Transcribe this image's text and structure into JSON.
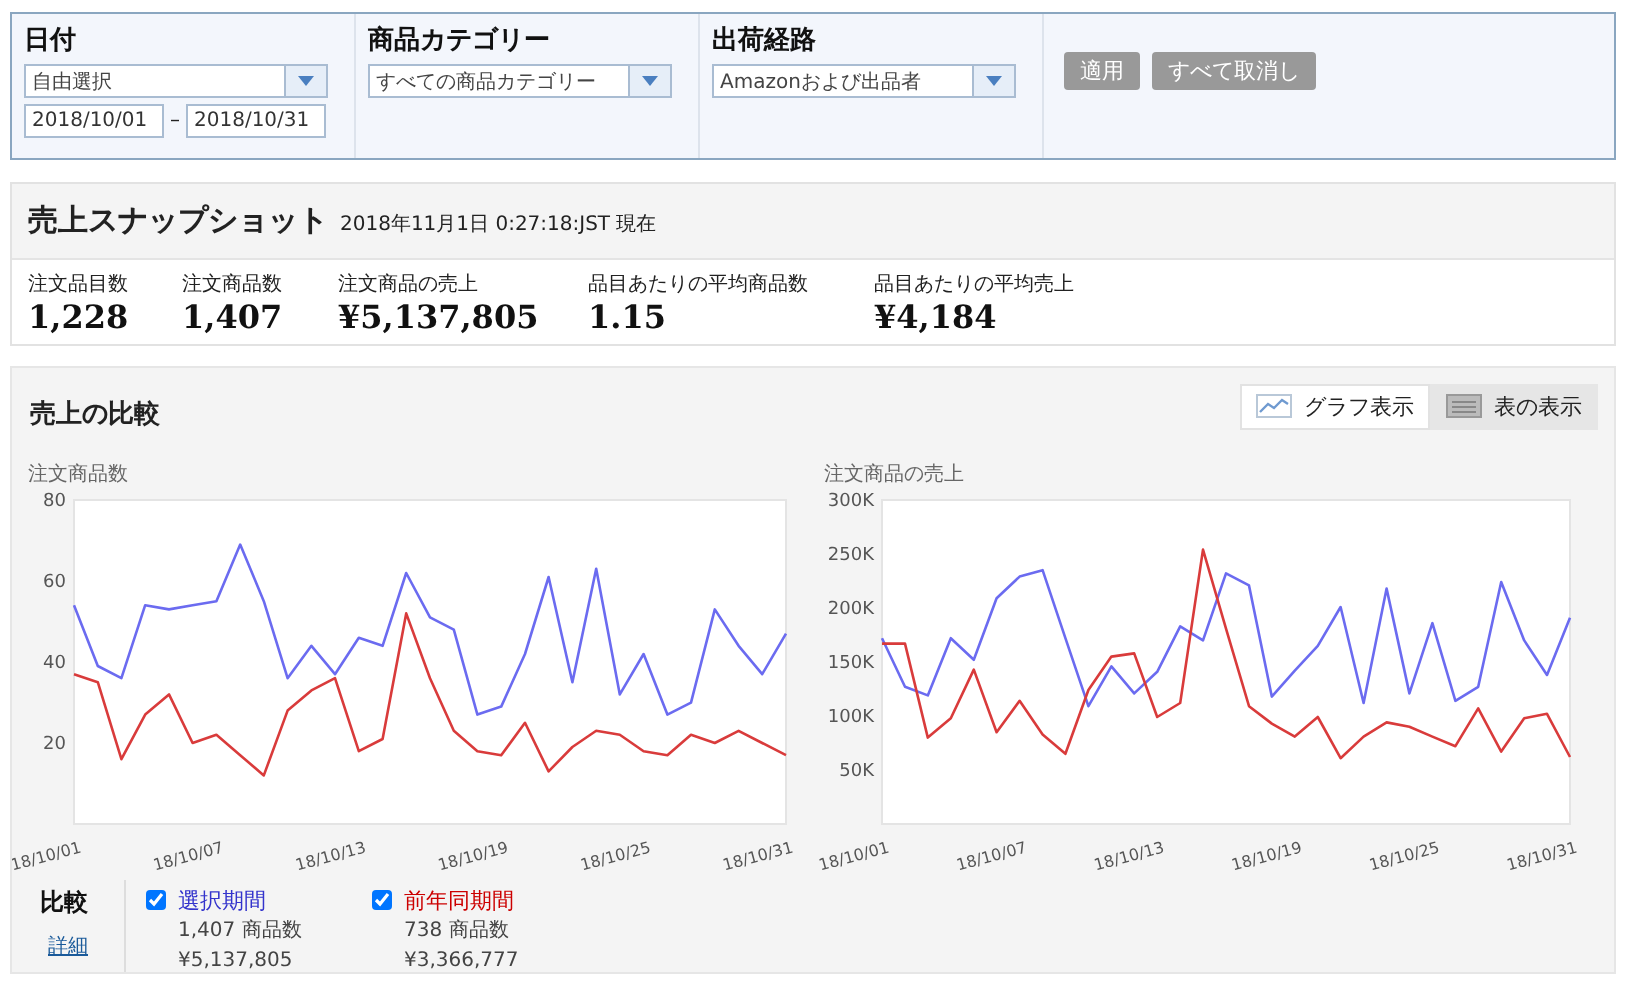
{
  "filters": {
    "columns": [
      {
        "kind": "date",
        "label": "日付",
        "dropdown": "自由選択",
        "from": "2018/10/01",
        "separator": "–",
        "to": "2018/10/31"
      },
      {
        "kind": "select",
        "label": "商品カテゴリー",
        "dropdown": "すべての商品カテゴリー"
      },
      {
        "kind": "select",
        "label": "出荷経路",
        "dropdown": "Amazonおよび出品者"
      }
    ],
    "buttons": [
      "適用",
      "すべて取消し"
    ]
  },
  "snapshot": {
    "title": "売上スナップショット",
    "timestamp": "2018年11月1日 0:27:18:JST 現在",
    "metrics": [
      {
        "label": "注文品目数",
        "value": "1,228"
      },
      {
        "label": "注文商品数",
        "value": "1,407"
      },
      {
        "label": "注文商品の売上",
        "value": "¥5,137,805"
      },
      {
        "label": "品目あたりの平均商品数",
        "value": "1.15"
      },
      {
        "label": "品目あたりの平均売上",
        "value": "¥4,184"
      }
    ]
  },
  "compare": {
    "title": "売上の比較",
    "views": [
      {
        "kind": "graph",
        "label": "グラフ表示",
        "selected": true
      },
      {
        "kind": "table",
        "label": "表の表示",
        "selected": false
      }
    ],
    "charts": [
      {
        "chart_data": {
          "type": "line",
          "title": "注文商品数",
          "categories": [
            "18/10/01",
            null,
            null,
            null,
            null,
            null,
            "18/10/07",
            null,
            null,
            null,
            null,
            null,
            "18/10/13",
            null,
            null,
            null,
            null,
            null,
            "18/10/19",
            null,
            null,
            null,
            null,
            null,
            "18/10/25",
            null,
            null,
            null,
            null,
            null,
            "18/10/31"
          ],
          "series": [
            {
              "color": "#6b6bf0",
              "values": [
                54,
                39,
                36,
                54,
                53,
                54,
                55,
                69,
                55,
                36,
                44,
                37,
                46,
                44,
                62,
                51,
                48,
                27,
                29,
                42,
                61,
                35,
                63,
                32,
                42,
                27,
                30,
                53,
                44,
                37,
                47
              ]
            },
            {
              "color": "#d93b3b",
              "values": [
                37,
                35,
                16,
                27,
                32,
                20,
                22,
                17,
                12,
                28,
                33,
                36,
                18,
                21,
                52,
                36,
                23,
                18,
                17,
                25,
                13,
                19,
                23,
                22,
                18,
                17,
                22,
                20,
                23,
                20,
                17
              ]
            }
          ],
          "ylim": [
            0,
            80
          ],
          "yticks": [
            20,
            40,
            60,
            80
          ]
        }
      },
      {
        "chart_data": {
          "type": "line",
          "title": "注文商品の売上",
          "categories": [
            "18/10/01",
            null,
            null,
            null,
            null,
            null,
            "18/10/07",
            null,
            null,
            null,
            null,
            null,
            "18/10/13",
            null,
            null,
            null,
            null,
            null,
            "18/10/19",
            null,
            null,
            null,
            null,
            null,
            "18/10/25",
            null,
            null,
            null,
            null,
            null,
            "18/10/31"
          ],
          "series": [
            {
              "color": "#6b6bf0",
              "values": [
                172000,
                127000,
                119000,
                172000,
                152000,
                209000,
                229000,
                235000,
                172000,
                109000,
                146000,
                121000,
                141000,
                183000,
                170000,
                232000,
                221000,
                118000,
                142000,
                165000,
                201000,
                112000,
                218000,
                121000,
                186000,
                114000,
                127000,
                224000,
                170000,
                138000,
                191000
              ]
            },
            {
              "color": "#d93b3b",
              "values": [
                167000,
                167000,
                80000,
                98000,
                143000,
                85000,
                114000,
                83000,
                65000,
                124000,
                155000,
                158000,
                99000,
                112000,
                254000,
                181000,
                109000,
                93000,
                81000,
                99000,
                61000,
                81000,
                94000,
                90000,
                81000,
                72000,
                107000,
                67000,
                98000,
                102000,
                62000
              ]
            }
          ],
          "ylim": [
            0,
            300000
          ],
          "yticks": [
            {
              "value": 50000,
              "label": "50K"
            },
            {
              "value": 100000,
              "label": "100K"
            },
            {
              "value": 150000,
              "label": "150K"
            },
            {
              "value": 200000,
              "label": "200K"
            },
            {
              "value": 250000,
              "label": "250K"
            },
            {
              "value": 300000,
              "label": "300K"
            }
          ]
        }
      }
    ],
    "legend": {
      "title": "比較",
      "link": "詳細",
      "items": [
        {
          "label": "選択期間",
          "checked": true,
          "color": "#3333cc",
          "count": "1,407 商品数",
          "sales": "¥5,137,805"
        },
        {
          "label": "前年同期間",
          "checked": true,
          "color": "#cc0000",
          "count": "738 商品数",
          "sales": "¥3,366,777"
        }
      ]
    }
  }
}
